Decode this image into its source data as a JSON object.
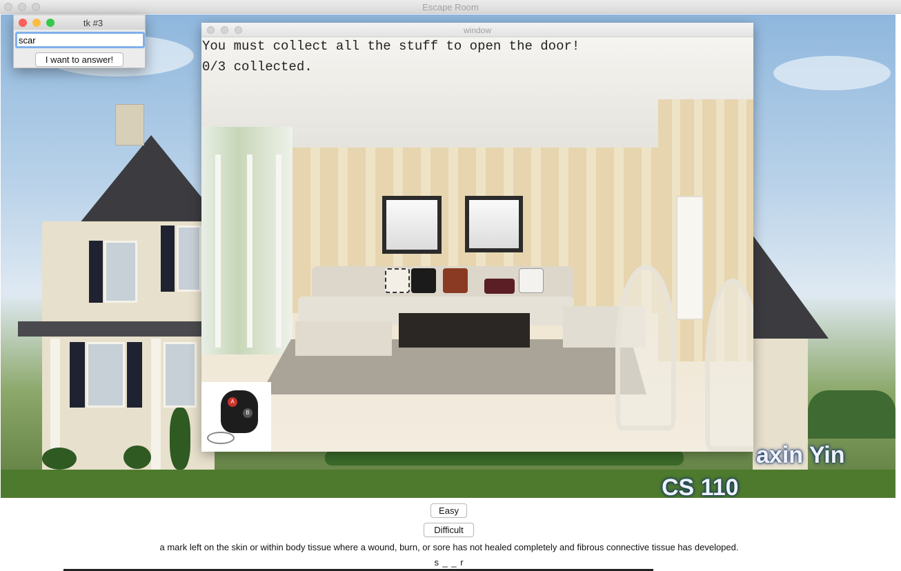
{
  "main_window": {
    "title": "Escape Room"
  },
  "scene": {
    "credits": {
      "line1": "axin Yin",
      "line2": "CS 110"
    }
  },
  "inner_window": {
    "title": "window",
    "message": "You must collect all the stuff to open the door!",
    "progress_text": "0/3 collected.",
    "item": {
      "icon": "car-key-remote-icon",
      "button_a": "A",
      "button_b": "B"
    }
  },
  "dialog": {
    "title": "tk #3",
    "input_value": "scar",
    "submit_label": "I want to answer!"
  },
  "controls": {
    "easy_label": "Easy",
    "difficult_label": "Difficult"
  },
  "clue": {
    "definition": "a mark left on the skin or within body tissue where a wound, burn, or sore has not healed completely and fibrous connective tissue has developed.",
    "hint": "s _ _ r"
  },
  "colors": {
    "close": "#fc605b",
    "minimize": "#fdbc40",
    "maximize": "#34c84a",
    "input_focus": "#7fb0ea"
  }
}
